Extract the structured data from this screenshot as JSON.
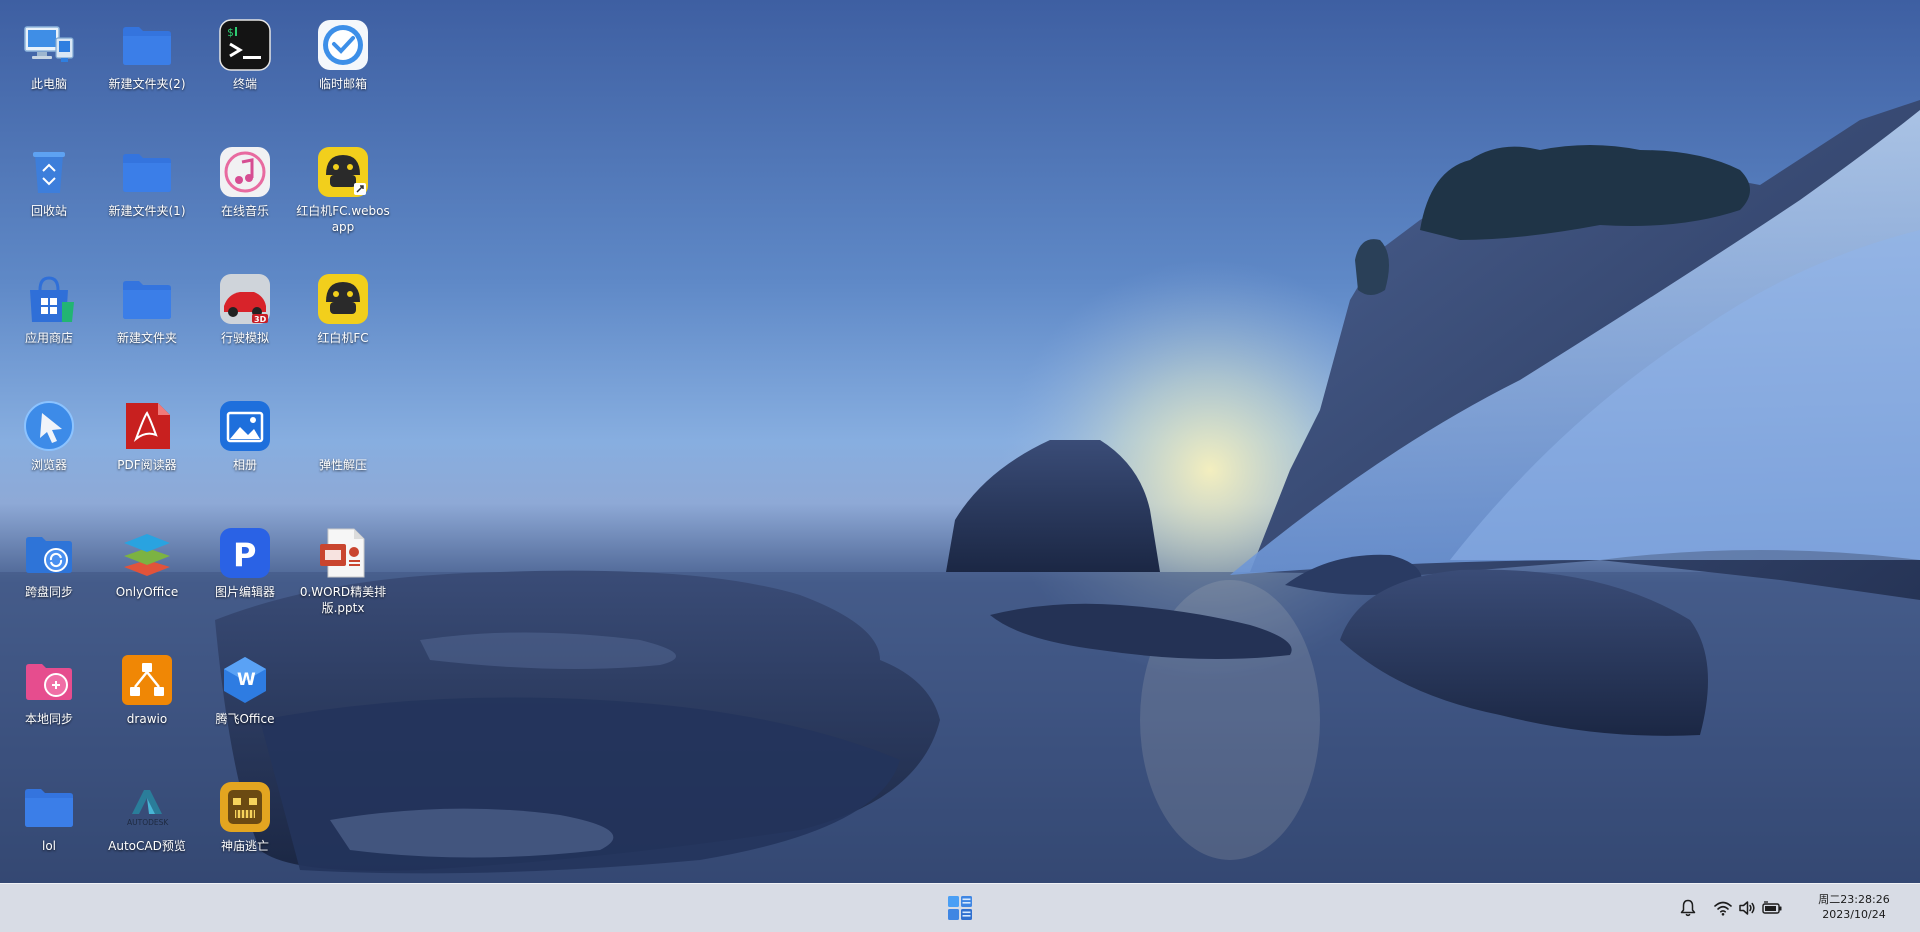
{
  "desktop": {
    "icons": [
      {
        "label": "此电脑",
        "icon": "computer-icon"
      },
      {
        "label": "新建文件夹(2)",
        "icon": "folder-icon"
      },
      {
        "label": "终端",
        "icon": "terminal-icon"
      },
      {
        "label": "临时邮箱",
        "icon": "mail-icon"
      },
      {
        "label": "回收站",
        "icon": "recycle-bin-icon"
      },
      {
        "label": "新建文件夹(1)",
        "icon": "folder-icon"
      },
      {
        "label": "在线音乐",
        "icon": "music-icon"
      },
      {
        "label": "红白机FC.webosapp",
        "icon": "fc-game-shortcut-icon"
      },
      {
        "label": "应用商店",
        "icon": "app-store-icon"
      },
      {
        "label": "新建文件夹",
        "icon": "folder-icon"
      },
      {
        "label": "行驶模拟",
        "icon": "racing-car-icon"
      },
      {
        "label": "红白机FC",
        "icon": "fc-game-icon"
      },
      {
        "label": "浏览器",
        "icon": "browser-icon"
      },
      {
        "label": "PDF阅读器",
        "icon": "pdf-icon"
      },
      {
        "label": "相册",
        "icon": "photo-album-icon"
      },
      {
        "label": "弹性解压",
        "icon": "blank-icon"
      },
      {
        "label": "跨盘同步",
        "icon": "cross-disk-sync-icon"
      },
      {
        "label": "OnlyOffice",
        "icon": "onlyoffice-icon"
      },
      {
        "label": "图片编辑器",
        "icon": "photo-editor-icon"
      },
      {
        "label": "0.WORD精美排版.pptx",
        "icon": "pptx-file-icon"
      },
      {
        "label": "本地同步",
        "icon": "local-sync-icon"
      },
      {
        "label": "drawio",
        "icon": "drawio-icon"
      },
      {
        "label": "腾飞Office",
        "icon": "office-w-icon"
      },
      {
        "label": "lol",
        "icon": "folder-icon"
      },
      {
        "label": "AutoCAD预览",
        "icon": "autocad-icon"
      },
      {
        "label": "神庙逃亡",
        "icon": "temple-run-icon"
      }
    ],
    "autocad_logo_text": "AUTODESK",
    "terminal_glyph": "$",
    "pdf_glyph": "⋀",
    "photo_editor_glyph": "P",
    "office_glyph": "W",
    "racing_badge": "3D"
  },
  "taskbar": {
    "start_icon": "windows-start-icon",
    "tray": {
      "notification_icon": "bell-icon",
      "wifi_icon": "wifi-icon",
      "volume_icon": "speaker-icon",
      "battery_icon": "battery-icon"
    },
    "clock": {
      "time": "周二23:28:26",
      "date": "2023/10/24"
    }
  },
  "colors": {
    "folder": "#3b7ee8",
    "taskbar": "#d6dae4",
    "accent": "#2d7be5"
  }
}
